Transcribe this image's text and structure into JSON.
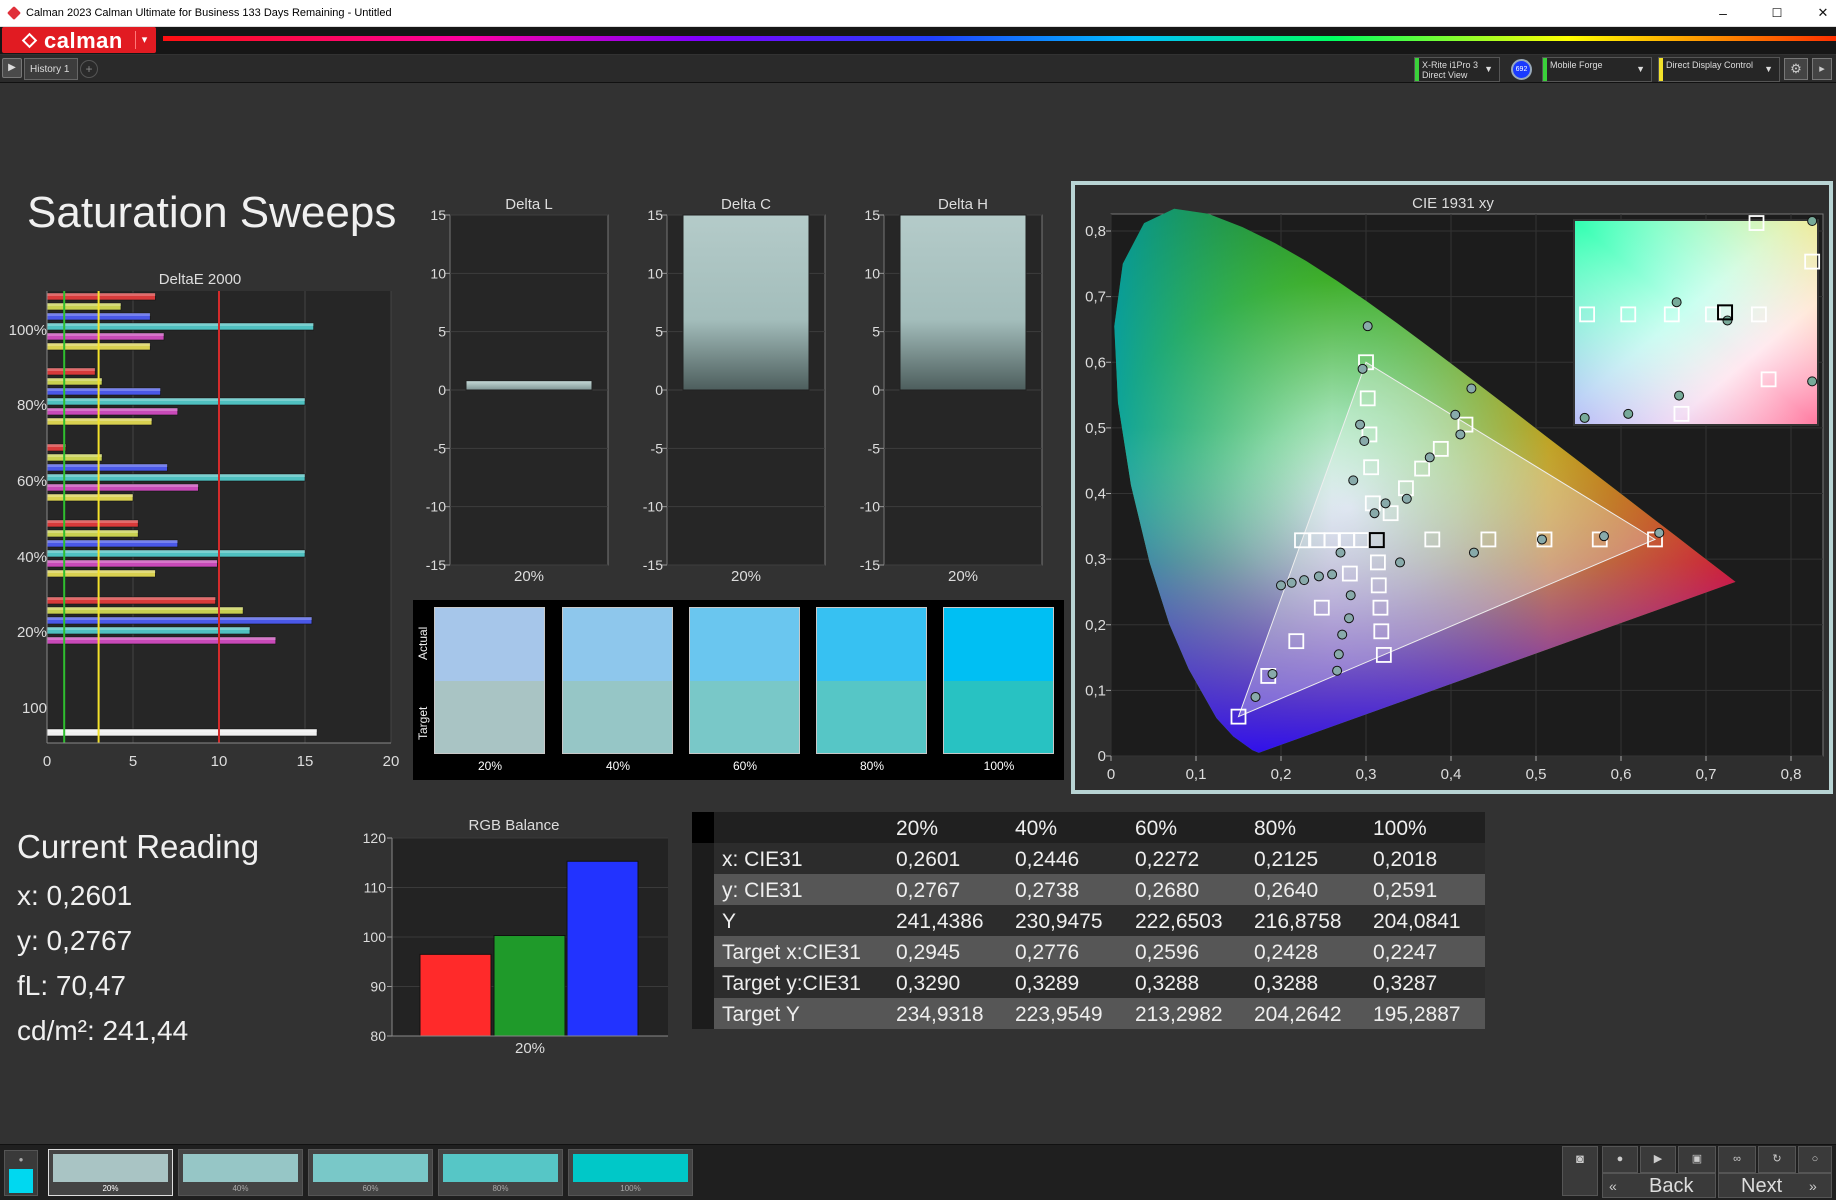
{
  "window": {
    "title": "Calman 2023 Calman Ultimate for Business 133 Days Remaining  - Untitled",
    "min": "–",
    "max": "☐",
    "close": "✕"
  },
  "brand": {
    "logo_text": "calman",
    "dropdown": "▾"
  },
  "tabs": {
    "play": "▶",
    "history_tab": "History 1",
    "add": "+"
  },
  "devices": [
    {
      "label_line1": "X-Rite i1Pro 3",
      "label_line2": "Direct View",
      "color": "#3ad13a"
    },
    {
      "label_line1": "Mobile Forge",
      "label_line2": "",
      "color": "#3ad13a"
    },
    {
      "label_line1": "Direct Display Control",
      "label_line2": "",
      "color": "#f3e22a"
    }
  ],
  "meter_badge": "692",
  "page_title": "Saturation Sweeps",
  "deltae_chart": {
    "title": "DeltaE 2000",
    "xticks": [
      "0",
      "5",
      "10",
      "15",
      "20"
    ],
    "row_labels": [
      "100%",
      "80%",
      "60%",
      "40%",
      "20%",
      "100"
    ],
    "thresholds": [
      {
        "value": 1,
        "color": "#2fbf2f"
      },
      {
        "value": 3,
        "color": "#f3e22a"
      },
      {
        "value": 10,
        "color": "#d42b2b"
      }
    ],
    "groups": [
      {
        "values": [
          6.3,
          4.3,
          6.0,
          15.5,
          6.8,
          6.0
        ]
      },
      {
        "values": [
          2.8,
          3.2,
          6.6,
          15.0,
          7.6,
          6.1
        ]
      },
      {
        "values": [
          1.1,
          3.2,
          7.0,
          15.0,
          8.8,
          5.0
        ]
      },
      {
        "values": [
          5.3,
          5.3,
          7.6,
          15.0,
          9.9,
          6.3
        ]
      },
      {
        "values": [
          9.8,
          11.4,
          15.4,
          11.8,
          13.3
        ]
      },
      {
        "values": [
          15.7
        ]
      }
    ],
    "group_colors": [
      "#d83a3a",
      "#c8d050",
      "#4a58e8",
      "#4fc0c0",
      "#c84ab8",
      "#d8d050"
    ]
  },
  "delta_charts": [
    {
      "title": "Delta L",
      "value": 0.8,
      "category": "20%"
    },
    {
      "title": "Delta C",
      "value": 15,
      "category": "20%"
    },
    {
      "title": "Delta H",
      "value": 15,
      "category": "20%"
    }
  ],
  "delta_yticks": [
    "15",
    "10",
    "5",
    "0",
    "-5",
    "-10",
    "-15"
  ],
  "swatches": {
    "actual_label": "Actual",
    "target_label": "Target",
    "items": [
      {
        "label": "20%",
        "actual": "#a6c6ea",
        "target": "#a9c4c4"
      },
      {
        "label": "40%",
        "actual": "#8ec7ec",
        "target": "#96c6c6"
      },
      {
        "label": "60%",
        "actual": "#6ac6ef",
        "target": "#79c8c8"
      },
      {
        "label": "80%",
        "actual": "#37c1f2",
        "target": "#56c6c6"
      },
      {
        "label": "100%",
        "actual": "#00bff3",
        "target": "#28c2c2"
      }
    ]
  },
  "cie": {
    "title": "CIE 1931 xy",
    "xticks": [
      "0",
      "0,1",
      "0,2",
      "0,3",
      "0,4",
      "0,5",
      "0,6",
      "0,7",
      "0,8"
    ],
    "yticks": [
      "0",
      "0,1",
      "0,2",
      "0,3",
      "0,4",
      "0,5",
      "0,6",
      "0,7",
      "0,8"
    ],
    "gamut": {
      "red": [
        0.64,
        0.33
      ],
      "green": [
        0.3,
        0.6
      ],
      "blue": [
        0.15,
        0.06
      ],
      "white": [
        0.3127,
        0.329
      ]
    },
    "targets": [
      [
        0.3,
        0.6
      ],
      [
        0.302,
        0.545
      ],
      [
        0.304,
        0.49
      ],
      [
        0.306,
        0.44
      ],
      [
        0.308,
        0.385
      ],
      [
        0.417,
        0.505
      ],
      [
        0.388,
        0.468
      ],
      [
        0.366,
        0.438
      ],
      [
        0.347,
        0.408
      ],
      [
        0.329,
        0.37
      ],
      [
        0.64,
        0.33
      ],
      [
        0.575,
        0.33
      ],
      [
        0.51,
        0.33
      ],
      [
        0.444,
        0.33
      ],
      [
        0.378,
        0.33
      ],
      [
        0.15,
        0.06
      ],
      [
        0.185,
        0.122
      ],
      [
        0.218,
        0.175
      ],
      [
        0.248,
        0.226
      ],
      [
        0.281,
        0.278
      ],
      [
        0.321,
        0.154
      ],
      [
        0.318,
        0.19
      ],
      [
        0.317,
        0.226
      ],
      [
        0.315,
        0.26
      ],
      [
        0.314,
        0.295
      ],
      [
        0.2247,
        0.3287
      ],
      [
        0.2428,
        0.3288
      ],
      [
        0.2596,
        0.3288
      ],
      [
        0.2776,
        0.3289
      ],
      [
        0.2945,
        0.329
      ]
    ],
    "measured": [
      [
        0.302,
        0.655
      ],
      [
        0.296,
        0.59
      ],
      [
        0.293,
        0.505
      ],
      [
        0.298,
        0.48
      ],
      [
        0.285,
        0.42
      ],
      [
        0.31,
        0.37
      ],
      [
        0.424,
        0.56
      ],
      [
        0.405,
        0.52
      ],
      [
        0.411,
        0.49
      ],
      [
        0.375,
        0.455
      ],
      [
        0.348,
        0.392
      ],
      [
        0.323,
        0.385
      ],
      [
        0.645,
        0.34
      ],
      [
        0.58,
        0.335
      ],
      [
        0.507,
        0.33
      ],
      [
        0.427,
        0.31
      ],
      [
        0.34,
        0.295
      ],
      [
        0.17,
        0.09
      ],
      [
        0.19,
        0.125
      ],
      [
        0.2,
        0.26
      ],
      [
        0.2125,
        0.264
      ],
      [
        0.2272,
        0.268
      ],
      [
        0.2446,
        0.2738
      ],
      [
        0.2601,
        0.2767
      ],
      [
        0.282,
        0.245
      ],
      [
        0.28,
        0.21
      ],
      [
        0.272,
        0.185
      ],
      [
        0.268,
        0.155
      ],
      [
        0.266,
        0.13
      ],
      [
        0.27,
        0.31
      ]
    ],
    "inset_targets": [
      [
        0.05,
        0.46
      ],
      [
        0.22,
        0.46
      ],
      [
        0.4,
        0.46
      ],
      [
        0.57,
        0.46
      ],
      [
        0.76,
        0.46
      ],
      [
        0.75,
        0.01
      ],
      [
        0.98,
        0.2
      ],
      [
        0.8,
        0.78
      ],
      [
        0.44,
        0.95
      ]
    ],
    "inset_measured": [
      [
        0.42,
        0.4
      ],
      [
        0.63,
        0.49
      ],
      [
        0.98,
        0.0
      ],
      [
        0.04,
        0.97
      ],
      [
        0.22,
        0.95
      ],
      [
        0.43,
        0.86
      ],
      [
        0.98,
        0.79
      ]
    ]
  },
  "reading": {
    "title": "Current Reading",
    "x": "x: 0,2601",
    "y": "y: 0,2767",
    "fl": "fL: 70,47",
    "cdm2": "cd/m²: 241,44"
  },
  "rgb_balance": {
    "title": "RGB Balance",
    "yticks": [
      "120",
      "110",
      "100",
      "90",
      "80"
    ],
    "ymin": 80,
    "ymax": 120,
    "category": "20%",
    "bars": [
      {
        "name": "R",
        "value": 96.5,
        "color": "#ff2a2a"
      },
      {
        "name": "G",
        "value": 100.3,
        "color": "#1f9a2a"
      },
      {
        "name": "B",
        "value": 115.3,
        "color": "#2233ff"
      }
    ]
  },
  "table": {
    "headers": [
      "",
      "20%",
      "40%",
      "60%",
      "80%",
      "100%"
    ],
    "rows": [
      [
        "x: CIE31",
        "0,2601",
        "0,2446",
        "0,2272",
        "0,2125",
        "0,2018"
      ],
      [
        "y: CIE31",
        "0,2767",
        "0,2738",
        "0,2680",
        "0,2640",
        "0,2591"
      ],
      [
        "Y",
        "241,4386",
        "230,9475",
        "222,6503",
        "216,8758",
        "204,0841"
      ],
      [
        "Target x:CIE31",
        "0,2945",
        "0,2776",
        "0,2596",
        "0,2428",
        "0,2247"
      ],
      [
        "Target y:CIE31",
        "0,3290",
        "0,3289",
        "0,3288",
        "0,3288",
        "0,3287"
      ],
      [
        "Target Y",
        "234,9318",
        "223,9549",
        "213,2982",
        "204,2642",
        "195,2887"
      ]
    ]
  },
  "bottom": {
    "current_color": "#00d8f0",
    "steps": [
      {
        "label": "20%",
        "color": "#a9c4c4"
      },
      {
        "label": "40%",
        "color": "#96c6c6"
      },
      {
        "label": "60%",
        "color": "#79c8c8"
      },
      {
        "label": "80%",
        "color": "#56c6c6"
      },
      {
        "label": "100%",
        "color": "#00c8c8"
      }
    ],
    "back": "Back",
    "next": "Next"
  }
}
